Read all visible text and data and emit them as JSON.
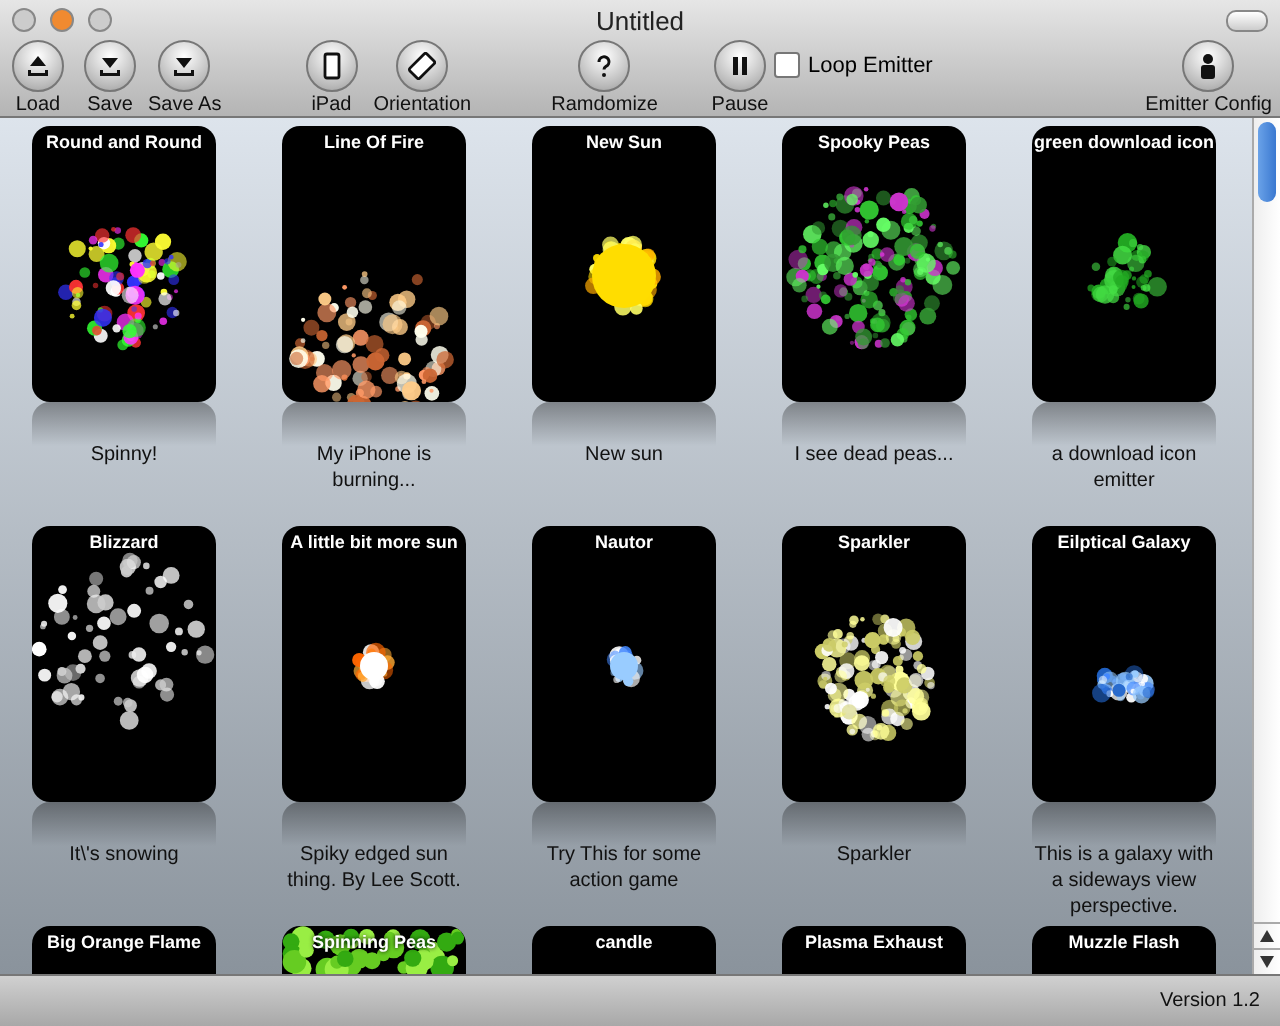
{
  "window": {
    "title": "Untitled"
  },
  "toolbar": {
    "buttons": [
      {
        "kind": "load",
        "label": "Load"
      },
      {
        "kind": "save",
        "label": "Save"
      },
      {
        "kind": "save",
        "label": "Save As"
      },
      {
        "kind": "ipad",
        "label": "iPad"
      },
      {
        "kind": "orientation",
        "label": "Orientation"
      },
      {
        "kind": "help",
        "label": "Ramdomize"
      },
      {
        "kind": "pause",
        "label": "Pause"
      }
    ],
    "loop_emitter": {
      "label": "Loop Emitter",
      "checked": false
    },
    "config_button": {
      "label": "Emitter Config"
    }
  },
  "emitters": [
    {
      "title": "Round and Round",
      "description": "Spinny!"
    },
    {
      "title": "Line Of Fire",
      "description": "My iPhone is burning..."
    },
    {
      "title": "New Sun",
      "description": "New sun"
    },
    {
      "title": "Spooky Peas",
      "description": "I see dead peas..."
    },
    {
      "title": "green download icon",
      "description": "a download icon emitter"
    },
    {
      "title": "Blizzard",
      "description": "It\\'s snowing"
    },
    {
      "title": "A little bit more sun",
      "description": "Spiky edged sun thing. By Lee Scott."
    },
    {
      "title": "Nautor",
      "description": "Try This for some action game"
    },
    {
      "title": "Sparkler",
      "description": "Sparkler"
    },
    {
      "title": "Eilptical Galaxy",
      "description": "This is a galaxy with a sideways view perspective."
    },
    {
      "title": "Big Orange Flame"
    },
    {
      "title": "Spinning Peas"
    },
    {
      "title": "candle"
    },
    {
      "title": "Plasma Exhaust"
    },
    {
      "title": "Muzzle Flash"
    }
  ],
  "status_bar": {
    "version": "Version 1.2"
  }
}
